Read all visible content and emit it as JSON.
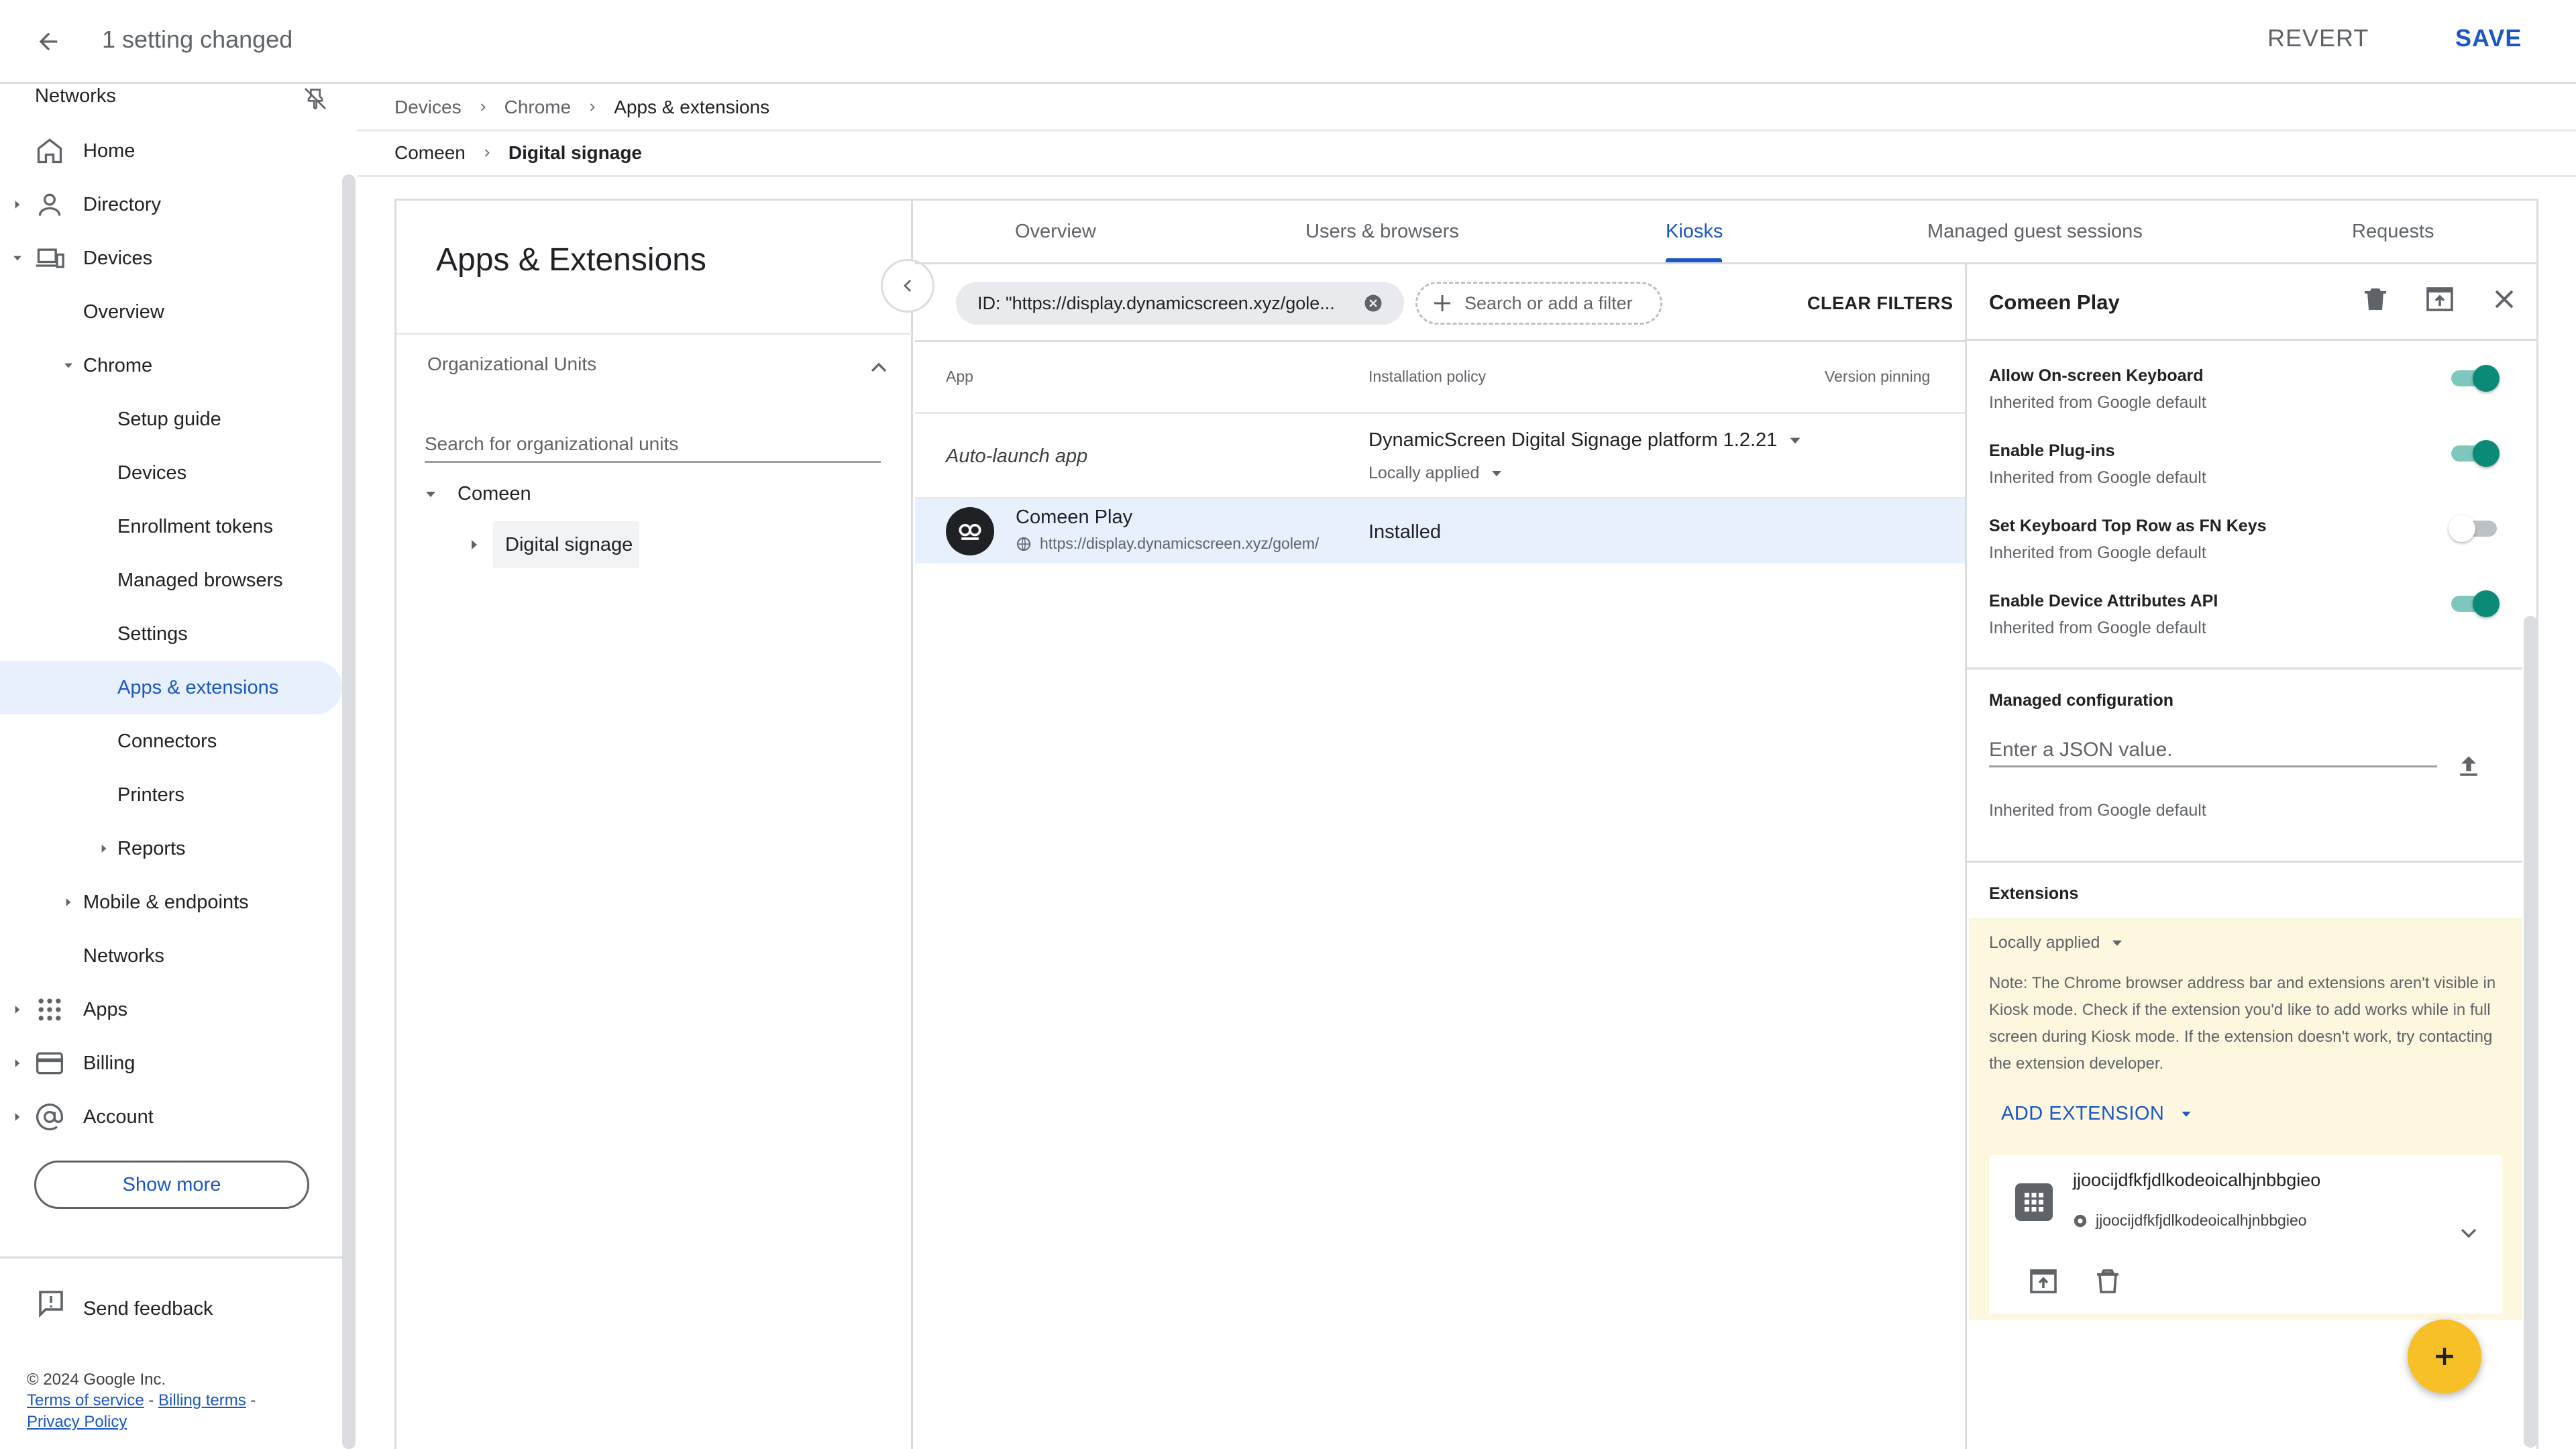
{
  "topbar": {
    "title": "1 setting changed",
    "revert_label": "REVERT",
    "save_label": "SAVE"
  },
  "sidebar": {
    "partial_top_label": "Networks",
    "items": [
      {
        "label": "Home",
        "icon": "home-icon"
      },
      {
        "label": "Directory",
        "icon": "person-icon"
      },
      {
        "label": "Devices",
        "icon": "devices-icon"
      },
      {
        "label": "Overview"
      },
      {
        "label": "Chrome"
      },
      {
        "label": "Setup guide"
      },
      {
        "label": "Devices"
      },
      {
        "label": "Enrollment tokens"
      },
      {
        "label": "Managed browsers"
      },
      {
        "label": "Settings"
      },
      {
        "label": "Apps & extensions"
      },
      {
        "label": "Connectors"
      },
      {
        "label": "Printers"
      },
      {
        "label": "Reports"
      },
      {
        "label": "Mobile & endpoints"
      },
      {
        "label": "Networks"
      },
      {
        "label": "Apps",
        "icon": "apps-grid-icon"
      },
      {
        "label": "Billing",
        "icon": "credit-card-icon"
      },
      {
        "label": "Account",
        "icon": "at-sign-icon"
      }
    ],
    "show_more": "Show more",
    "feedback": "Send feedback",
    "copyright": "© 2024 Google Inc.",
    "terms": "Terms of service",
    "billing_terms": "Billing terms",
    "privacy": "Privacy Policy",
    "sep": " - "
  },
  "breadcrumb": {
    "row1": [
      "Devices",
      "Chrome",
      "Apps & extensions"
    ],
    "row2": [
      "Comeen",
      "Digital signage"
    ]
  },
  "left_panel": {
    "title": "Apps & Extensions",
    "ou_header": "Organizational Units",
    "search_placeholder": "Search for organizational units",
    "tree_root": "Comeen",
    "tree_child": "Digital signage"
  },
  "tabs": [
    {
      "label": "Overview"
    },
    {
      "label": "Users & browsers"
    },
    {
      "label": "Kiosks",
      "active": true
    },
    {
      "label": "Managed guest sessions"
    },
    {
      "label": "Requests"
    }
  ],
  "filters": {
    "chip": "ID: \"https://display.dynamicscreen.xyz/gole...",
    "add_placeholder": "Search or add a filter",
    "clear": "CLEAR FILTERS"
  },
  "table": {
    "headers": [
      "App",
      "Installation policy",
      "Version pinning"
    ],
    "auto_launch_label": "Auto-launch app",
    "auto_launch_value": "DynamicScreen Digital Signage platform 1.2.21",
    "locally_applied": "Locally applied",
    "app": {
      "name": "Comeen Play",
      "url": "https://display.dynamicscreen.xyz/golem/",
      "status": "Installed"
    }
  },
  "detail": {
    "title": "Comeen Play",
    "settings": [
      {
        "title": "Allow On-screen Keyboard",
        "sub": "Inherited from Google default",
        "on": true
      },
      {
        "title": "Enable Plug-ins",
        "sub": "Inherited from Google default",
        "on": true
      },
      {
        "title": "Set Keyboard Top Row as FN Keys",
        "sub": "Inherited from Google default",
        "on": false
      },
      {
        "title": "Enable Device Attributes API",
        "sub": "Inherited from Google default",
        "on": true
      }
    ],
    "managed_config": {
      "title": "Managed configuration",
      "placeholder": "Enter a JSON value.",
      "inherited": "Inherited from Google default"
    },
    "extensions": {
      "title": "Extensions",
      "locally_applied": "Locally applied",
      "note": "Note: The Chrome browser address bar and extensions aren't visible in Kiosk mode. Check if the extension you'd like to add works while in full screen during Kiosk mode. If the extension doesn't work, try contacting the extension developer.",
      "add_label": "ADD EXTENSION",
      "item_name": "jjoocijdfkfjdlkodeoicalhjnbbgieo",
      "item_id": "jjoocijdfkfjdlkodeoicalhjnbbgieo"
    }
  },
  "colors": {
    "accent": "#1a56c4",
    "toggle_on": "#0b8a78",
    "fab": "#f6c026",
    "ext_bg": "#fef7e0"
  }
}
